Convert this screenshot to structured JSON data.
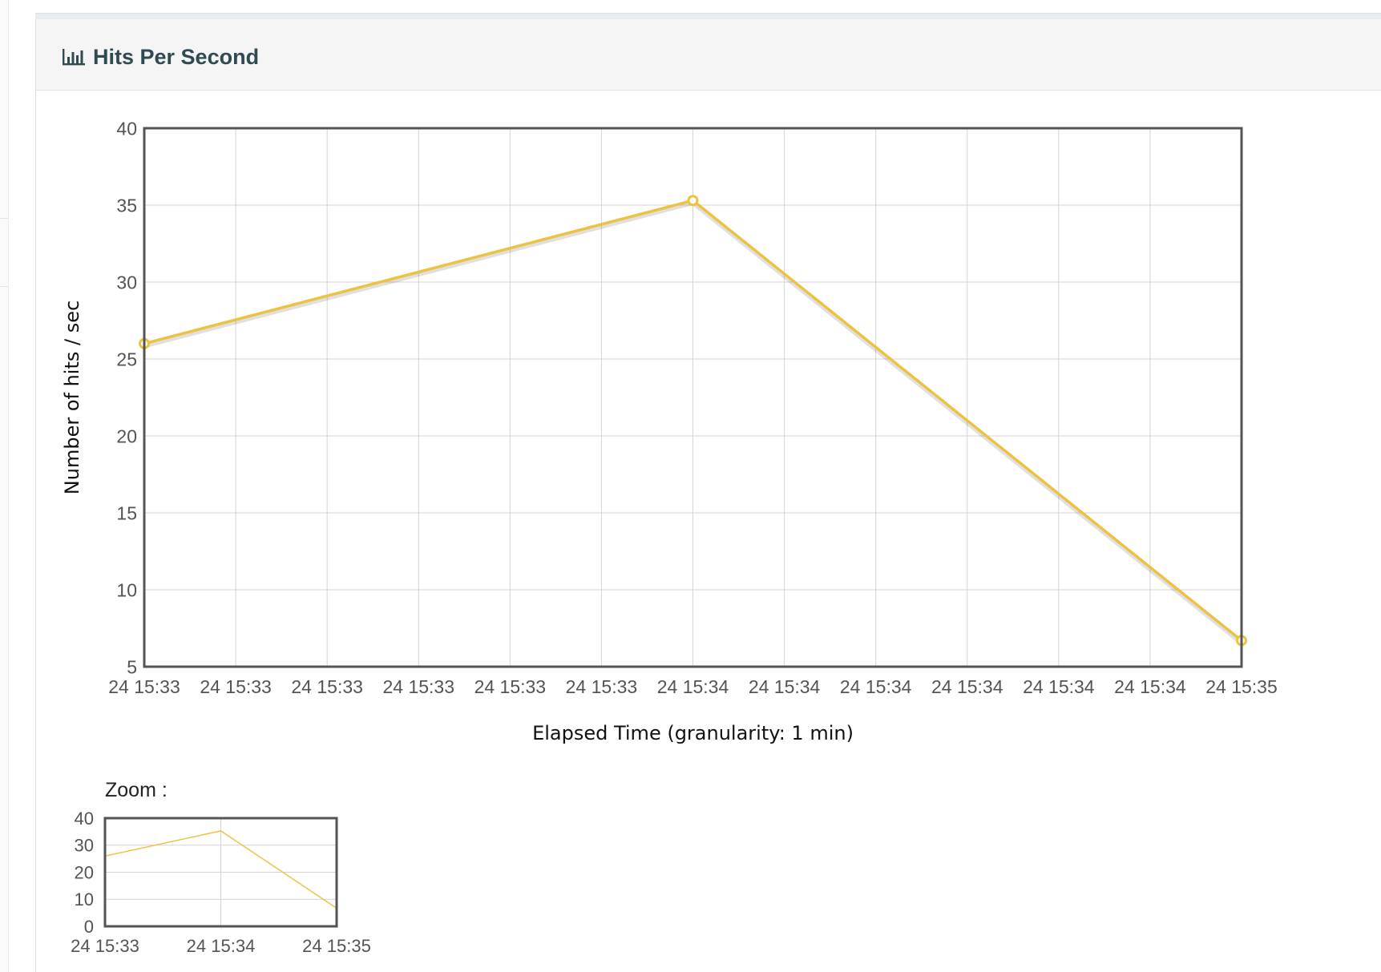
{
  "panel": {
    "title": "Hits Per Second",
    "icon": "bar-chart-icon",
    "zoom_label": "Zoom :"
  },
  "colors": {
    "series": "#edc240",
    "grid": "#d4d4d4",
    "axis_border": "#545454",
    "tick_text": "#545454",
    "heading_bg": "#f5f5f5",
    "title_text": "#2f4b51"
  },
  "chart_data": [
    {
      "type": "line",
      "title": "",
      "xlabel": "Elapsed Time (granularity: 1 min)",
      "ylabel": "Number of hits / sec",
      "ylim": [
        5,
        40
      ],
      "yticks": [
        "5",
        "10",
        "15",
        "20",
        "25",
        "30",
        "35",
        "40"
      ],
      "xticks": [
        "24 15:33",
        "24 15:33",
        "24 15:33",
        "24 15:33",
        "24 15:33",
        "24 15:33",
        "24 15:34",
        "24 15:34",
        "24 15:34",
        "24 15:34",
        "24 15:34",
        "24 15:34",
        "24 15:35"
      ],
      "x": [
        "24 15:33",
        "24 15:34",
        "24 15:35"
      ],
      "series": [
        {
          "name": "",
          "values": [
            26,
            35.3,
            6.7
          ],
          "markers": true
        }
      ],
      "grid": true,
      "legend": "none"
    },
    {
      "type": "line",
      "title": "",
      "xlabel": "",
      "ylabel": "",
      "ylim": [
        0,
        40
      ],
      "yticks": [
        "0",
        "10",
        "20",
        "30",
        "40"
      ],
      "xticks": [
        "24 15:33",
        "24 15:34",
        "24 15:35"
      ],
      "x": [
        "24 15:33",
        "24 15:34",
        "24 15:35"
      ],
      "series": [
        {
          "name": "",
          "values": [
            26,
            35.3,
            6.7
          ],
          "markers": false
        }
      ],
      "grid": true,
      "legend": "none"
    }
  ]
}
